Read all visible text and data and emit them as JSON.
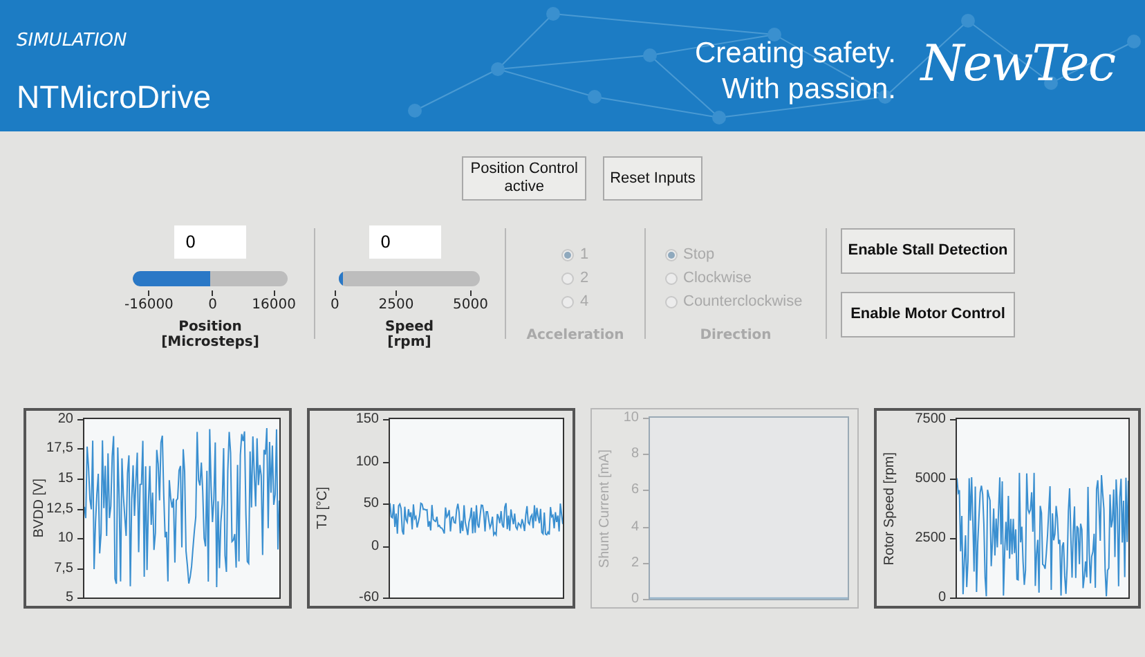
{
  "header": {
    "mode": "SIMULATION",
    "title": "NTMicroDrive",
    "slogan": [
      "Creating safety.",
      "With passion."
    ],
    "logo": "NewTec"
  },
  "top_buttons": [
    {
      "label": "Position Control active"
    },
    {
      "label": "Reset Inputs"
    }
  ],
  "sliders": [
    {
      "value": "0",
      "level": 0.5,
      "ticks": [
        "-16000",
        "0",
        "16000"
      ],
      "title": "Position",
      "unit": "[Microsteps]"
    },
    {
      "value": "0",
      "level": 0.03,
      "ticks": [
        "0",
        "2500",
        "5000"
      ],
      "title": "Speed",
      "unit": "[rpm]"
    }
  ],
  "radio_groups": [
    {
      "title": "Acceleration",
      "disabled": true,
      "options": [
        {
          "label": "1",
          "selected": true
        },
        {
          "label": "2",
          "selected": false
        },
        {
          "label": "4",
          "selected": false
        }
      ]
    },
    {
      "title": "Direction",
      "disabled": true,
      "options": [
        {
          "label": "Stop",
          "selected": true
        },
        {
          "label": "Clockwise",
          "selected": false
        },
        {
          "label": "Counterclockwise",
          "selected": false
        }
      ]
    }
  ],
  "side_buttons": [
    {
      "label": "Enable Stall Detection"
    },
    {
      "label": "Enable Motor Control"
    }
  ],
  "charts": [
    {
      "ylabel": "BVDD [V]",
      "yticks": [
        "20",
        "17,5",
        "15",
        "12,5",
        "10",
        "7,5",
        "5"
      ],
      "disabled": false
    },
    {
      "ylabel": "TJ [°C]",
      "yticks": [
        "150",
        "100",
        "50",
        "0",
        "-60"
      ],
      "disabled": false
    },
    {
      "ylabel": "Shunt Current [mA]",
      "yticks": [
        "10",
        "8",
        "6",
        "4",
        "2",
        "0"
      ],
      "disabled": true
    },
    {
      "ylabel": "Rotor Speed [rpm]",
      "yticks": [
        "7500",
        "5000",
        "2500",
        "0"
      ],
      "disabled": false
    }
  ]
}
